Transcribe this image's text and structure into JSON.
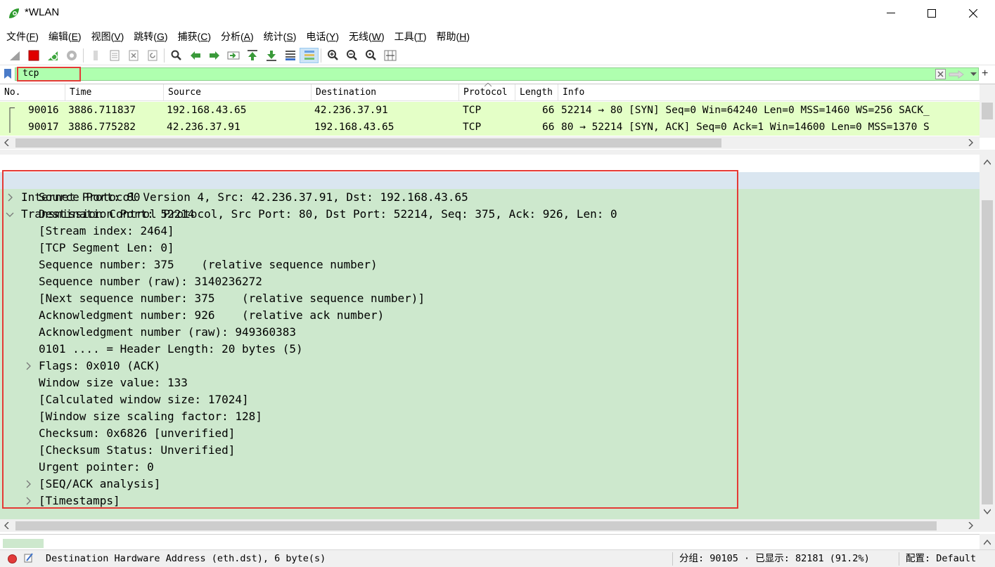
{
  "window": {
    "title": "*WLAN",
    "controls": {
      "minimize": "minimize",
      "maximize": "maximize",
      "close": "close"
    }
  },
  "menu": [
    {
      "label": "文件(",
      "key": "F",
      "suffix": ")"
    },
    {
      "label": "编辑(",
      "key": "E",
      "suffix": ")"
    },
    {
      "label": "视图(",
      "key": "V",
      "suffix": ")"
    },
    {
      "label": "跳转(",
      "key": "G",
      "suffix": ")"
    },
    {
      "label": "捕获(",
      "key": "C",
      "suffix": ")"
    },
    {
      "label": "分析(",
      "key": "A",
      "suffix": ")"
    },
    {
      "label": "统计(",
      "key": "S",
      "suffix": ")"
    },
    {
      "label": "电话(",
      "key": "Y",
      "suffix": ")"
    },
    {
      "label": "无线(",
      "key": "W",
      "suffix": ")"
    },
    {
      "label": "工具(",
      "key": "T",
      "suffix": ")"
    },
    {
      "label": "帮助(",
      "key": "H",
      "suffix": ")"
    }
  ],
  "toolbar_icons": [
    "shark-fin-start-icon",
    "stop-capture-icon",
    "restart-capture-icon",
    "capture-options-icon",
    "open-file-icon",
    "save-file-icon",
    "close-file-icon",
    "reload-file-icon",
    "find-packet-icon",
    "go-back-icon",
    "go-forward-icon",
    "go-to-packet-icon",
    "go-first-icon",
    "go-last-icon",
    "autoscroll-icon",
    "colorize-icon",
    "zoom-in-icon",
    "zoom-out-icon",
    "zoom-normal-icon",
    "resize-columns-icon"
  ],
  "filter": {
    "value": "tcp",
    "bookmark_icon": "bookmark-icon",
    "clear_icon": "clear-filter-icon",
    "apply_icon": "apply-filter-arrow-icon",
    "dropdown_icon": "filter-dropdown-icon",
    "add_button": "+"
  },
  "packet_list": {
    "columns": [
      "No.",
      "Time",
      "Source",
      "Destination",
      "Protocol",
      "Length",
      "Info"
    ],
    "rows": [
      {
        "no": "90016",
        "time": "3886.711837",
        "source": "192.168.43.65",
        "destination": "42.236.37.91",
        "protocol": "TCP",
        "length": "66",
        "info": "52214 → 80 [SYN] Seq=0 Win=64240 Len=0 MSS=1460 WS=256 SACK_"
      },
      {
        "no": "90017",
        "time": "3886.775282",
        "source": "42.236.37.91",
        "destination": "192.168.43.65",
        "protocol": "TCP",
        "length": "66",
        "info": "80 → 52214 [SYN, ACK] Seq=0 Ack=1 Win=14600 Len=0 MSS=1370 S"
      }
    ]
  },
  "details": {
    "ip_line": "Internet Protocol Version 4, Src: 42.236.37.91, Dst: 192.168.43.65",
    "tcp_line": "Transmission Control Protocol, Src Port: 80, Dst Port: 52214, Seq: 375, Ack: 926, Len: 0",
    "fields": [
      {
        "text": "Source Port: 80",
        "expandable": false
      },
      {
        "text": "Destination Port: 52214",
        "expandable": false
      },
      {
        "text": "[Stream index: 2464]",
        "expandable": false
      },
      {
        "text": "[TCP Segment Len: 0]",
        "expandable": false
      },
      {
        "text": "Sequence number: 375    (relative sequence number)",
        "expandable": false
      },
      {
        "text": "Sequence number (raw): 3140236272",
        "expandable": false
      },
      {
        "text": "[Next sequence number: 375    (relative sequence number)]",
        "expandable": false
      },
      {
        "text": "Acknowledgment number: 926    (relative ack number)",
        "expandable": false
      },
      {
        "text": "Acknowledgment number (raw): 949360383",
        "expandable": false
      },
      {
        "text": "0101 .... = Header Length: 20 bytes (5)",
        "expandable": false
      },
      {
        "text": "Flags: 0x010 (ACK)",
        "expandable": true
      },
      {
        "text": "Window size value: 133",
        "expandable": false
      },
      {
        "text": "[Calculated window size: 17024]",
        "expandable": false
      },
      {
        "text": "[Window size scaling factor: 128]",
        "expandable": false
      },
      {
        "text": "Checksum: 0x6826 [unverified]",
        "expandable": false
      },
      {
        "text": "[Checksum Status: Unverified]",
        "expandable": false
      },
      {
        "text": "Urgent pointer: 0",
        "expandable": false
      },
      {
        "text": "[SEQ/ACK analysis]",
        "expandable": true
      },
      {
        "text": "[Timestamps]",
        "expandable": true
      }
    ]
  },
  "status": {
    "field_info": "Destination Hardware Address (eth.dst), 6 byte(s)",
    "packets": "分组: 90105 · 已显示: 82181 (91.2%)",
    "profile": "配置: Default"
  },
  "colors": {
    "filter_valid": "#afffaf",
    "packet_row": "#e4ffc7",
    "details_bg": "#cde8cd",
    "selected_row": "#dae6f0",
    "highlight_box": "#e53935"
  }
}
